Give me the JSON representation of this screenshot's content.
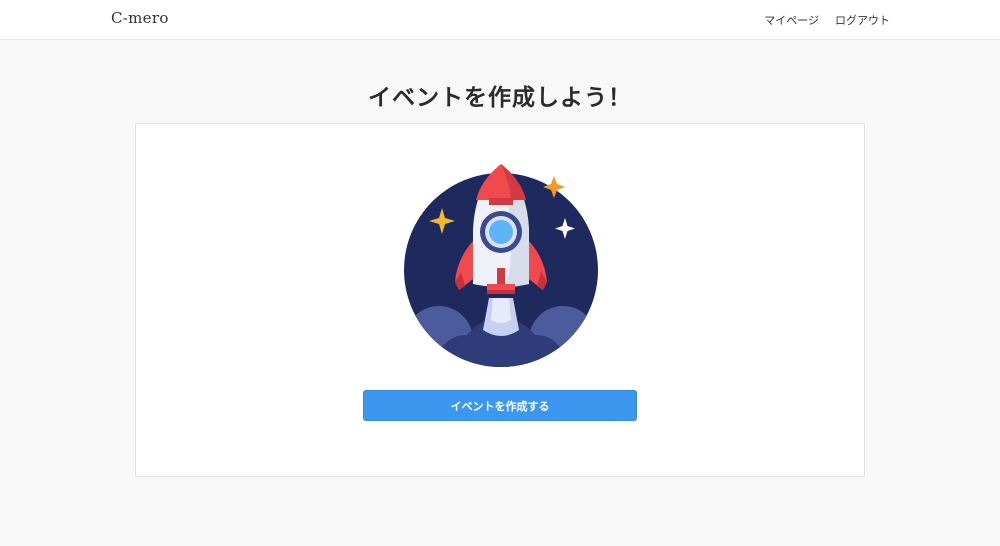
{
  "header": {
    "brand": "C-mero",
    "links": [
      {
        "label": "マイページ"
      },
      {
        "label": "ログアウト"
      }
    ]
  },
  "main": {
    "title": "イベントを作成しよう！",
    "illustration_icon": "rocket-launch-icon",
    "create_button_label": "イベントを作成する"
  },
  "colors": {
    "accent": "#3c97ef",
    "circle": "#1e2a5e",
    "rocket_red": "#f04a4f",
    "star_gold": "#f5b92a",
    "background": "#f8f8f8"
  }
}
